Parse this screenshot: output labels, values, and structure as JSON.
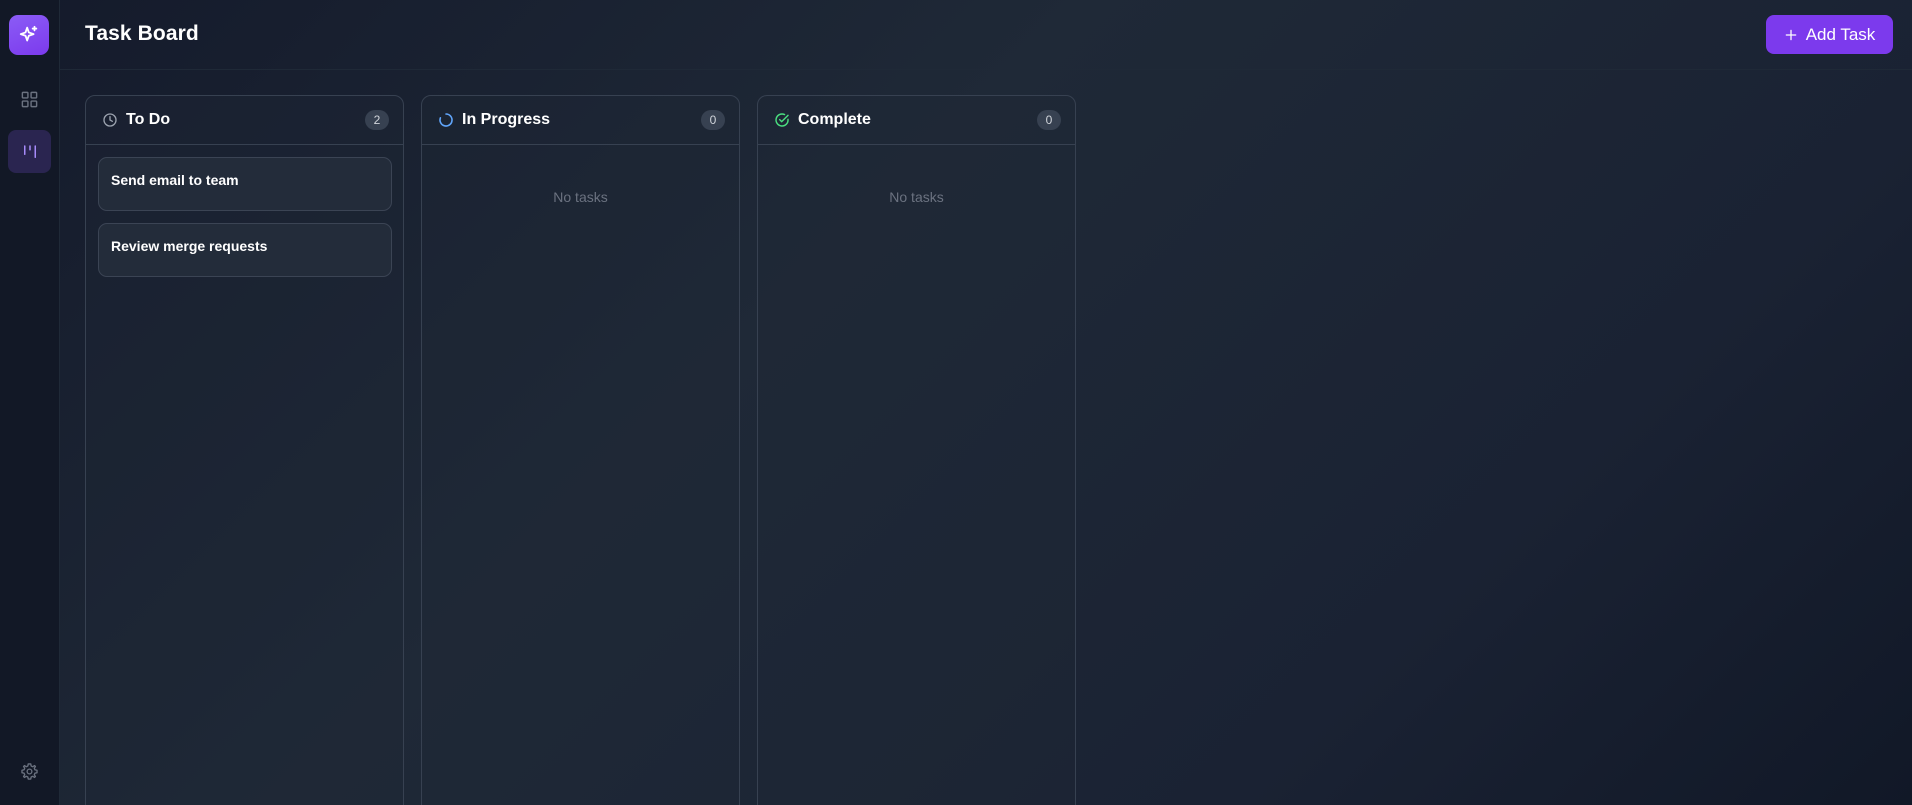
{
  "header": {
    "title": "Task Board",
    "add_task_label": "Add Task"
  },
  "sidebar": {
    "items": [
      {
        "icon": "dashboard-grid-icon"
      },
      {
        "icon": "kanban-board-icon",
        "active": true
      },
      {
        "icon": "gear-icon"
      }
    ]
  },
  "columns": [
    {
      "title": "To Do",
      "count": "2",
      "icon": "clock-icon",
      "tasks": [
        {
          "title": "Send email to team"
        },
        {
          "title": "Review merge requests"
        }
      ]
    },
    {
      "title": "In Progress",
      "count": "0",
      "icon": "loading-icon",
      "empty_text": "No tasks"
    },
    {
      "title": "Complete",
      "count": "0",
      "icon": "check-circle-icon",
      "empty_text": "No tasks"
    }
  ],
  "colors": {
    "accent": "#7c3aed",
    "in_progress_icon": "#60a5fa",
    "complete_icon": "#4ade80",
    "background": "#111827"
  }
}
